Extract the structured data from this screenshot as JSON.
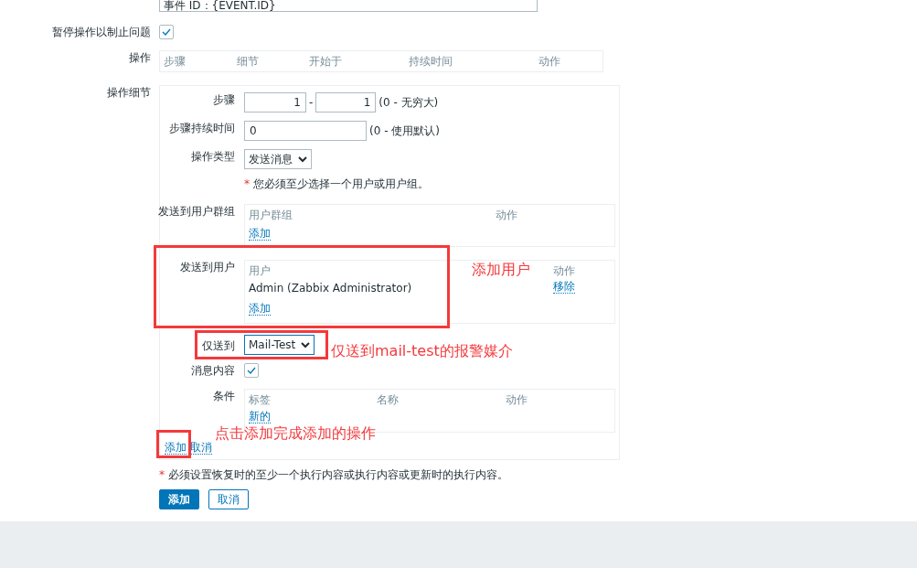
{
  "message_field": {
    "value": "事件 ID：{EVENT.ID}"
  },
  "pause_option": {
    "label": "暂停操作以制止问题",
    "checked": true
  },
  "operations": {
    "label": "操作",
    "columns": [
      "步骤",
      "细节",
      "开始于",
      "持续时间",
      "动作"
    ]
  },
  "operation_details": {
    "label": "操作细节",
    "steps": {
      "label": "步骤",
      "from": "1",
      "separator": "-",
      "to": "1",
      "hint": "(0 - 无穷大)"
    },
    "step_duration": {
      "label": "步骤持续时间",
      "value": "0",
      "hint": "(0 - 使用默认)"
    },
    "operation_type": {
      "label": "操作类型",
      "value": "发送消息"
    },
    "required_note": {
      "mark": "*",
      "text": "您必须至少选择一个用户或用户组。"
    },
    "user_groups": {
      "label": "发送到用户群组",
      "columns": [
        "用户群组",
        "动作"
      ],
      "add_link": "添加"
    },
    "users": {
      "label": "发送到用户",
      "columns": [
        "用户",
        "动作"
      ],
      "rows": [
        {
          "name": "Admin (Zabbix Administrator)",
          "action": "移除"
        }
      ],
      "add_link": "添加"
    },
    "send_only_to": {
      "label": "仅送到",
      "value": "Mail-Test"
    },
    "custom_message": {
      "label": "消息内容",
      "checked": true
    },
    "conditions": {
      "label": "条件",
      "columns": [
        "标签",
        "名称",
        "动作"
      ],
      "new_link": "新的"
    },
    "links": [
      "添加",
      "取消"
    ]
  },
  "footer_note": {
    "mark": "*",
    "text": "必须设置恢复时的至少一个执行内容或执行内容或更新时的执行内容。"
  },
  "buttons": [
    {
      "label": "添加",
      "primary": true
    },
    {
      "label": "取消",
      "primary": false
    }
  ],
  "annotations": [
    {
      "text": "添加用户"
    },
    {
      "text": "仅送到mail-test的报警媒介"
    },
    {
      "text": "点击添加完成添加的操作"
    }
  ]
}
